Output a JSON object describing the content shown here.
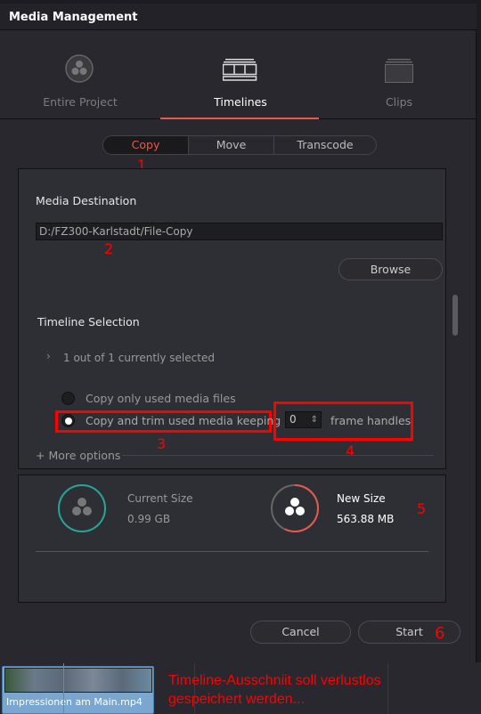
{
  "window": {
    "title": "Media Management"
  },
  "tabs": [
    {
      "label": "Entire Project",
      "icon": "resolve-logo-icon"
    },
    {
      "label": "Timelines",
      "icon": "timeline-icon",
      "active": true
    },
    {
      "label": "Clips",
      "icon": "clip-icon"
    }
  ],
  "modes": [
    "Copy",
    "Move",
    "Transcode"
  ],
  "active_mode": "Copy",
  "destination": {
    "label": "Media Destination",
    "value": "D:/FZ300-Karlstadt/File-Copy",
    "browse": "Browse"
  },
  "timeline_selection": {
    "label": "Timeline Selection",
    "summary": "1 out of 1 currently selected"
  },
  "options": {
    "copy_only": "Copy only used media files",
    "copy_trim": "Copy and trim used media keeping",
    "handles_value": "0",
    "handles_label": "frame handles",
    "more": "+ More options"
  },
  "sizes": {
    "current_label": "Current Size",
    "current_value": "0.99 GB",
    "new_label": "New Size",
    "new_value": "563.88 MB",
    "new_fraction": 0.57
  },
  "buttons": {
    "cancel": "Cancel",
    "start": "Start"
  },
  "clip": {
    "name": "Impressionen am Main.mp4"
  },
  "annotations": {
    "n1": "1",
    "n2": "2",
    "n3": "3",
    "n4": "4",
    "n5": "5",
    "n6": "6",
    "note_line1": "Timeline-Ausschniit soll verlustlos",
    "note_line2": "gespeichert werden..."
  },
  "colors": {
    "accent": "#e8584c",
    "teal": "#26a59a",
    "annotation": "#ff0000"
  }
}
